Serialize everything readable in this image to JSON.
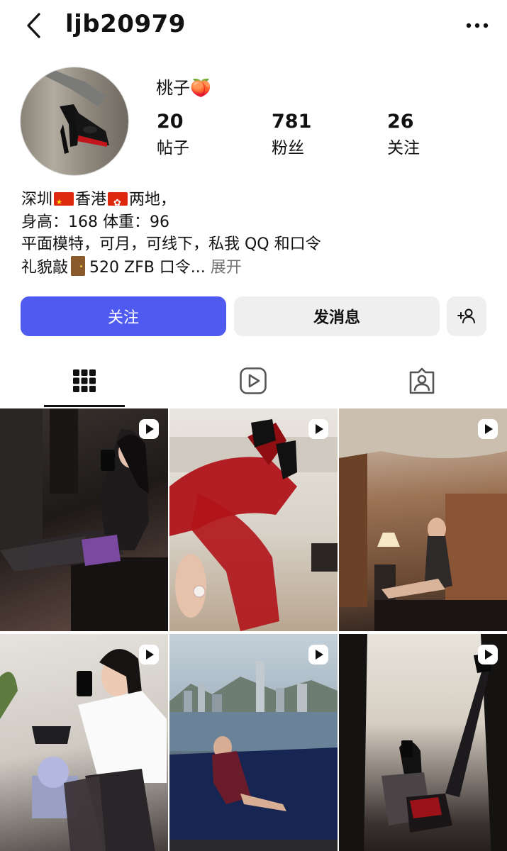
{
  "header": {
    "username": "ljb20979"
  },
  "profile": {
    "display_name": "桃子🍑",
    "stats": [
      {
        "value": "20",
        "label": "帖子"
      },
      {
        "value": "781",
        "label": "粉丝"
      },
      {
        "value": "26",
        "label": "关注"
      }
    ]
  },
  "bio": {
    "line1_a": "深圳",
    "line1_b": "香港",
    "line1_c": "两地，",
    "line2": "身高：168 体重：96",
    "line3": "平面模特，可月，可线下，私我 QQ 和口令",
    "line4_a": "礼貌敲",
    "line4_b": "520 ZFB 口令...",
    "more": " 展开"
  },
  "buttons": {
    "follow": "关注",
    "message": "发消息"
  },
  "icons": {
    "back": "back-arrow-icon",
    "more": "more-horizontal-icon",
    "add_user": "add-user-icon",
    "grid_tab": "grid-icon",
    "reels_tab": "reels-icon",
    "tagged_tab": "tagged-icon",
    "reel_badge": "reel-badge-icon"
  },
  "colors": {
    "accent": "#4f5bf0",
    "secondary_button": "#efefef",
    "muted_text": "#737373"
  }
}
